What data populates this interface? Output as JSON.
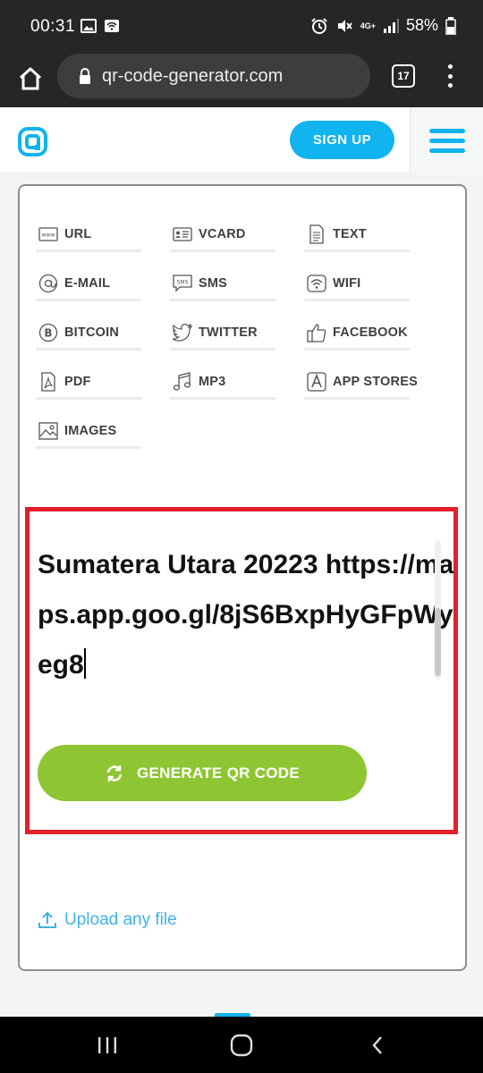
{
  "status_bar": {
    "time": "00:31",
    "network": "4G+",
    "battery": "58%"
  },
  "browser": {
    "url": "qr-code-generator.com",
    "tab_count": "17"
  },
  "header": {
    "signup_label": "SIGN UP"
  },
  "qr_types": [
    {
      "label": "URL",
      "icon": "www-icon"
    },
    {
      "label": "VCARD",
      "icon": "vcard-icon"
    },
    {
      "label": "TEXT",
      "icon": "document-icon"
    },
    {
      "label": "E-MAIL",
      "icon": "at-icon"
    },
    {
      "label": "SMS",
      "icon": "sms-icon"
    },
    {
      "label": "WIFI",
      "icon": "wifi-icon"
    },
    {
      "label": "BITCOIN",
      "icon": "bitcoin-icon"
    },
    {
      "label": "TWITTER",
      "icon": "twitter-icon"
    },
    {
      "label": "FACEBOOK",
      "icon": "thumbs-up-icon"
    },
    {
      "label": "PDF",
      "icon": "pdf-icon"
    },
    {
      "label": "MP3",
      "icon": "music-note-icon"
    },
    {
      "label": "APP STORES",
      "icon": "app-store-icon"
    },
    {
      "label": "IMAGES",
      "icon": "image-icon"
    }
  ],
  "text_input": {
    "value": "Sumatera Utara 20223 https://maps.app.goo.gl/8jS6BxpHyGFpWyeg8"
  },
  "generate_button": {
    "label": "GENERATE QR CODE"
  },
  "upload_link": {
    "label": "Upload any file"
  },
  "colors": {
    "brand_blue": "#11b4ef",
    "generate_green": "#8ec633",
    "highlight_red": "#e3202a"
  }
}
